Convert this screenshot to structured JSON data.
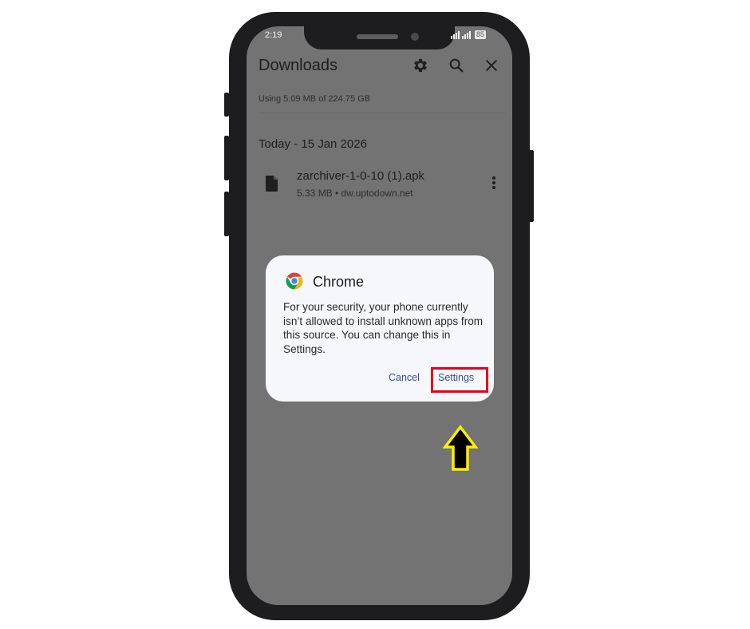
{
  "status_bar": {
    "time": "2:19",
    "battery": "85"
  },
  "app_bar": {
    "title": "Downloads",
    "icons": [
      "gear-icon",
      "search-icon",
      "close-icon"
    ]
  },
  "storage_text": "Using 5.09 MB of 224.75 GB",
  "section_header": "Today - 15 Jan 2026",
  "downloads": [
    {
      "name": "zarchiver-1-0-10 (1).apk",
      "meta": "5.33 MB • dw.uptodown.net",
      "icon": "file-icon"
    }
  ],
  "dialog": {
    "app_name": "Chrome",
    "message": "For your security, your phone currently isn’t allowed to install unknown apps from this source. You can change this in Settings.",
    "cancel_label": "Cancel",
    "settings_label": "Settings"
  },
  "annotation_colors": {
    "highlight": "#e3001b",
    "arrow_fill": "#000000",
    "arrow_outline": "#ffee00"
  }
}
